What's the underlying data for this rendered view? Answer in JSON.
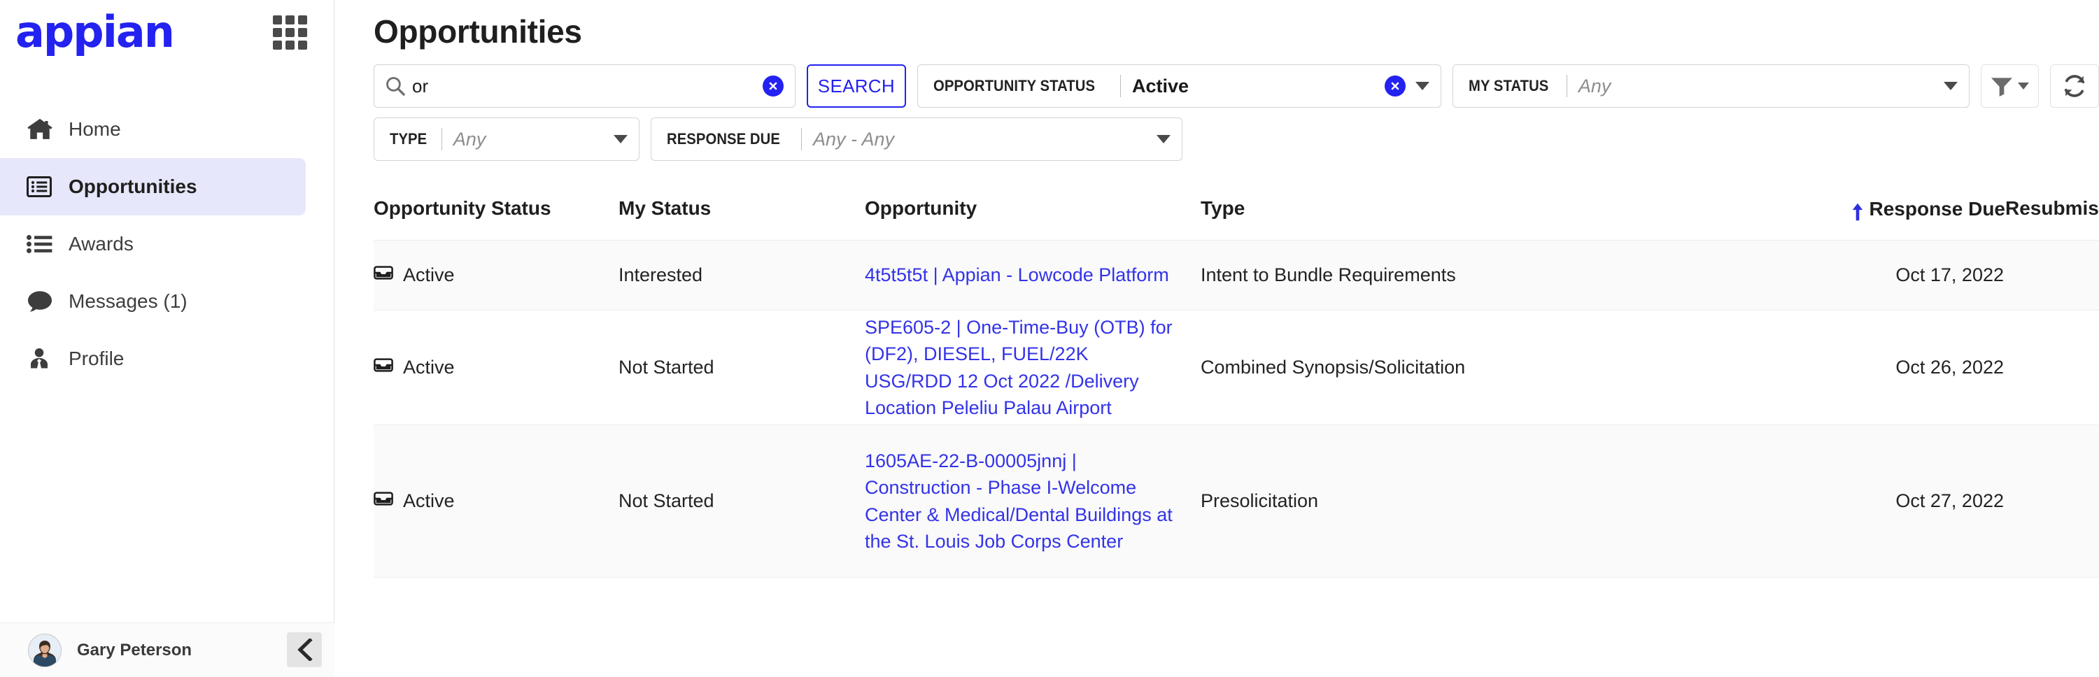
{
  "brand": {
    "logo_text": "appian",
    "logo_color": "#2322f0",
    "accent_color": "#2322f0",
    "link_color": "#3333e8",
    "active_nav_bg": "#e7e7fb"
  },
  "sidebar": {
    "apps_icon": "grid-apps-icon",
    "items": [
      {
        "label": "Home",
        "icon": "home-icon",
        "active": false
      },
      {
        "label": "Opportunities",
        "icon": "list-box-icon",
        "active": true
      },
      {
        "label": "Awards",
        "icon": "bulleted-list-icon",
        "active": false
      },
      {
        "label": "Messages (1)",
        "icon": "chat-bubble-icon",
        "active": false
      },
      {
        "label": "Profile",
        "icon": "user-tie-icon",
        "active": false
      }
    ],
    "user": {
      "name": "Gary Peterson",
      "avatar": "user-photo-avatar"
    },
    "collapse_icon": "chevron-left-icon"
  },
  "header": {
    "title": "Opportunities"
  },
  "search": {
    "icon": "search-icon",
    "value": "or",
    "placeholder": "",
    "clear_icon": "clear-circle-icon",
    "button_label": "SEARCH"
  },
  "filters": [
    {
      "name": "opportunity-status",
      "label": "OPPORTUNITY STATUS",
      "value": "Active",
      "is_placeholder": false,
      "has_clear": true,
      "clear_icon": "clear-circle-icon",
      "caret_icon": "chevron-down-icon"
    },
    {
      "name": "my-status",
      "label": "MY STATUS",
      "value": "Any",
      "is_placeholder": true,
      "has_clear": false,
      "caret_icon": "chevron-down-icon"
    },
    {
      "name": "type",
      "label": "TYPE",
      "value": "Any",
      "is_placeholder": true,
      "has_clear": false,
      "caret_icon": "chevron-down-icon"
    },
    {
      "name": "response-due",
      "label": "RESPONSE DUE",
      "value": "Any - Any",
      "is_placeholder": true,
      "has_clear": false,
      "caret_icon": "chevron-down-icon"
    }
  ],
  "toolbar": {
    "filter_icon": "funnel-filter-icon",
    "filter_caret_icon": "chevron-down-icon",
    "refresh_icon": "refresh-sync-icon"
  },
  "table": {
    "columns": [
      {
        "key": "opportunity_status",
        "label": "Opportunity Status",
        "sorted": false
      },
      {
        "key": "my_status",
        "label": "My Status",
        "sorted": false
      },
      {
        "key": "opportunity",
        "label": "Opportunity",
        "sorted": false
      },
      {
        "key": "type",
        "label": "Type",
        "sorted": false
      },
      {
        "key": "response_due",
        "label": "Response Due",
        "sorted": true,
        "sort_direction": "asc",
        "sort_icon": "sort-arrow-up-icon"
      },
      {
        "key": "resubmission",
        "label": "Resubmission/",
        "sorted": false,
        "truncated": true
      }
    ],
    "rows": [
      {
        "status_icon": "inbox-archive-icon",
        "opportunity_status": "Active",
        "my_status": "Interested",
        "opportunity": "4t5t5t5t | Appian - Lowcode Platform",
        "type": "Intent to Bundle Requirements",
        "response_due": "Oct 17, 2022",
        "resubmission": ""
      },
      {
        "status_icon": "inbox-archive-icon",
        "opportunity_status": "Active",
        "my_status": "Not Started",
        "opportunity": "SPE605-2 | One-Time-Buy (OTB) for (DF2), DIESEL, FUEL/22K USG/RDD 12 Oct 2022 /Delivery Location Peleliu Palau Airport",
        "type": "Combined Synopsis/Solicitation",
        "response_due": "Oct 26, 2022",
        "resubmission": ""
      },
      {
        "status_icon": "inbox-archive-icon",
        "opportunity_status": "Active",
        "my_status": "Not Started",
        "opportunity": "1605AE-22-B-00005jnnj | Construction - Phase I-Welcome Center & Medical/Dental Buildings at the St. Louis Job Corps Center",
        "type": "Presolicitation",
        "response_due": "Oct 27, 2022",
        "resubmission": ""
      }
    ]
  }
}
